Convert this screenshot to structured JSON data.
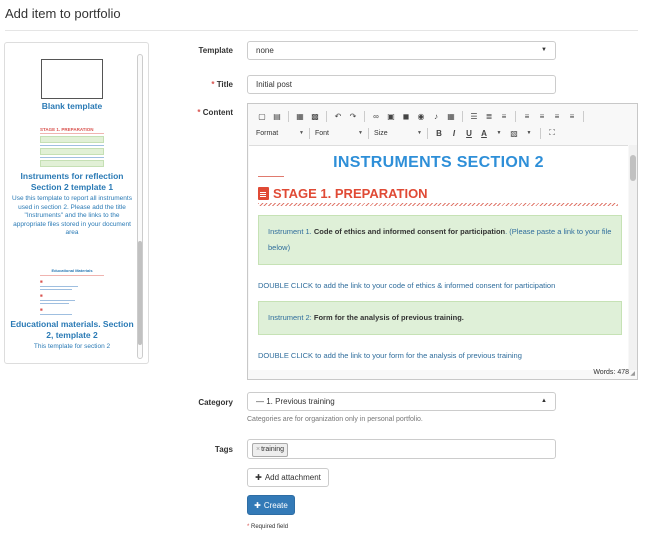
{
  "page": {
    "title": "Add item to portfolio"
  },
  "templates": [
    {
      "name": "Blank template",
      "description": ""
    },
    {
      "name": "Instruments for reflection Section 2 template 1",
      "description": "Use this template to report all instruments used in section 2. Please add the title \"Instruments\" and the links to the appropriate files stored in your document area",
      "thumb_heading": "STAGE 1. PREPARATION"
    },
    {
      "name": "Educational materials. Section 2, template 2",
      "description": "This template for section 2",
      "thumb_heading": "Educational Materials"
    }
  ],
  "form": {
    "template_label": "Template",
    "template_value": "none",
    "title_label": "Title",
    "title_value": "Initial post",
    "content_label": "Content",
    "category_label": "Category",
    "category_value": "— 1. Previous training",
    "category_help": "Categories are for organization only in personal portfolio.",
    "tags_label": "Tags",
    "tags": [
      "training"
    ],
    "attach_label": "Add attachment",
    "create_label": "Create",
    "required_note": "Required field",
    "required_mark": "*"
  },
  "editor": {
    "toolbar_combos": {
      "format": "Format",
      "font": "Font",
      "size": "Size"
    },
    "word_count": "Words: 478",
    "content": {
      "heading": "INSTRUMENTS SECTION 2",
      "stage": "STAGE 1. PREPARATION",
      "box1_prefix": "Instrument 1. ",
      "box1_bold": "Code of ethics and informed consent for participation",
      "box1_suffix": ". (Please paste a link to your file below)",
      "link1": "DOUBLE CLICK to add the link to your code of ethics & informed consent for participation",
      "box2_prefix": "Instrument 2: ",
      "box2_bold": "Form for the analysis of previous training.",
      "link2": "DOUBLE CLICK to add the link to your form for the analysis of previous training"
    }
  },
  "colors": {
    "primary": "#337ab7",
    "accent_red": "#e04a35",
    "heading_blue": "#2e8fd8",
    "box_green": "#dff0d8"
  }
}
